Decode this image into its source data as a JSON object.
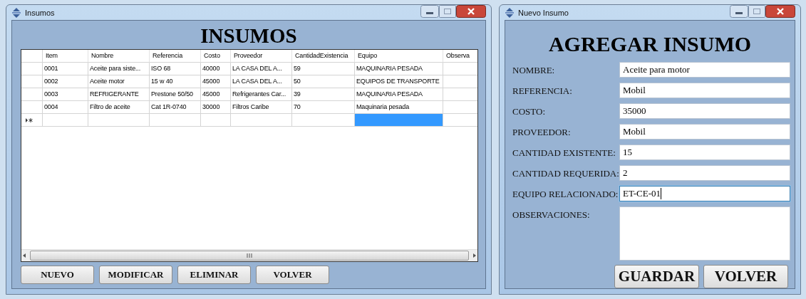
{
  "list_window": {
    "title": "Insumos",
    "heading": "INSUMOS",
    "table": {
      "columns": [
        "Item",
        "Nombre",
        "Referencia",
        "Costo",
        "Proveedor",
        "CantidadExistencia",
        "Equipo",
        "Observa"
      ],
      "rows": [
        [
          "0001",
          "Aceite para siste...",
          "ISO 68",
          "40000",
          "LA CASA DEL A...",
          "59",
          "MAQUINARIA PESADA"
        ],
        [
          "0002",
          "Aceite motor",
          "15 w 40",
          "45000",
          "LA CASA DEL A...",
          "50",
          "EQUIPOS DE TRANSPORTE"
        ],
        [
          "0003",
          "REFRIGERANTE",
          "Prestone 50/50",
          "45000",
          "Refrigerantes Car...",
          "39",
          "MAQUINARIA PESADA"
        ],
        [
          "0004",
          "Filtro de aceite",
          "Cat 1R-0740",
          "30000",
          "Filtros Caribe",
          "70",
          "Maquinaria pesada"
        ]
      ],
      "new_row": [
        {
          "selected": false
        },
        {
          "selected": false
        },
        {
          "selected": false
        },
        {
          "selected": false
        },
        {
          "selected": false
        },
        {
          "selected": false
        },
        {
          "selected": true
        },
        {
          "selected": false
        }
      ]
    },
    "buttons": [
      "NUEVO",
      "MODIFICAR",
      "ELIMINAR",
      "VOLVER"
    ]
  },
  "form_window": {
    "title": "Nuevo Insumo",
    "heading": "AGREGAR INSUMO",
    "fields": [
      {
        "label": "NOMBRE:",
        "value": "Aceite para motor",
        "focused": false,
        "kind": "line"
      },
      {
        "label": "REFERENCIA:",
        "value": "Mobil",
        "focused": false,
        "kind": "line"
      },
      {
        "label": "COSTO:",
        "value": "35000",
        "focused": false,
        "kind": "line"
      },
      {
        "label": "PROVEEDOR:",
        "value": "Mobil",
        "focused": false,
        "kind": "line"
      },
      {
        "label": "CANTIDAD EXISTENTE:",
        "value": "15",
        "focused": false,
        "kind": "line"
      },
      {
        "label": "CANTIDAD REQUERIDA:",
        "value": "2",
        "focused": false,
        "kind": "line"
      },
      {
        "label": "EQUIPO RELACIONADO:",
        "value": "ET-CE-01",
        "focused": true,
        "kind": "line"
      },
      {
        "label": "OBSERVACIONES:",
        "focused": false,
        "kind": "multiline"
      }
    ],
    "buttons": [
      "GUARDAR",
      "VOLVER"
    ]
  }
}
